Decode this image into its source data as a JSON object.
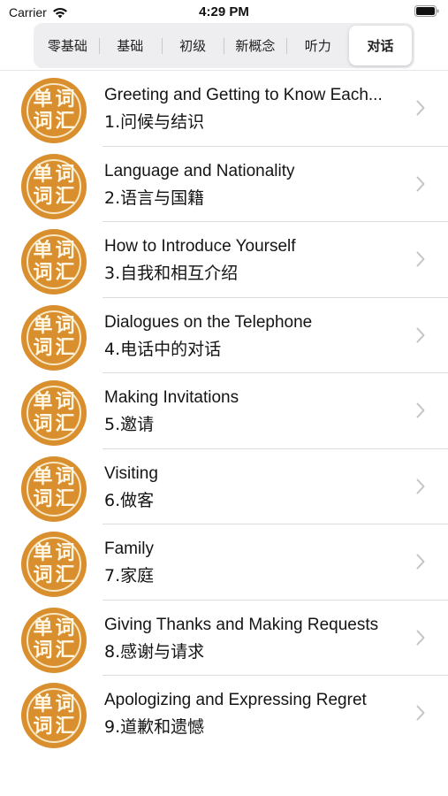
{
  "status_bar": {
    "carrier": "Carrier",
    "time": "4:29 PM"
  },
  "tabs": [
    {
      "label": "零基础",
      "active": false
    },
    {
      "label": "基础",
      "active": false
    },
    {
      "label": "初级",
      "active": false
    },
    {
      "label": "新概念",
      "active": false
    },
    {
      "label": "听力",
      "active": false
    },
    {
      "label": "对话",
      "active": true
    }
  ],
  "lessons": [
    {
      "title": "Greeting and Getting to Know Each...",
      "subtitle": "1.问候与结识"
    },
    {
      "title": "Language and Nationality",
      "subtitle": "2.语言与国籍"
    },
    {
      "title": "How to Introduce Yourself",
      "subtitle": "3.自我和相互介绍"
    },
    {
      "title": "Dialogues on the Telephone",
      "subtitle": "4.电话中的对话"
    },
    {
      "title": "Making Invitations",
      "subtitle": "5.邀请"
    },
    {
      "title": "Visiting",
      "subtitle": "6.做客"
    },
    {
      "title": "Family",
      "subtitle": "7.家庭"
    },
    {
      "title": "Giving Thanks and Making Requests",
      "subtitle": "8.感谢与请求"
    },
    {
      "title": "Apologizing and Expressing Regret",
      "subtitle": "9.道歉和遗憾"
    }
  ],
  "badge": {
    "chars": [
      "单",
      "词",
      "词",
      "汇"
    ],
    "icon": "vocabulary-badge-icon",
    "color": "#d98f2d"
  },
  "colors": {
    "accent": "#d98f2d",
    "segment_bg": "#eeeef0",
    "chevron": "#c4c4c7"
  }
}
